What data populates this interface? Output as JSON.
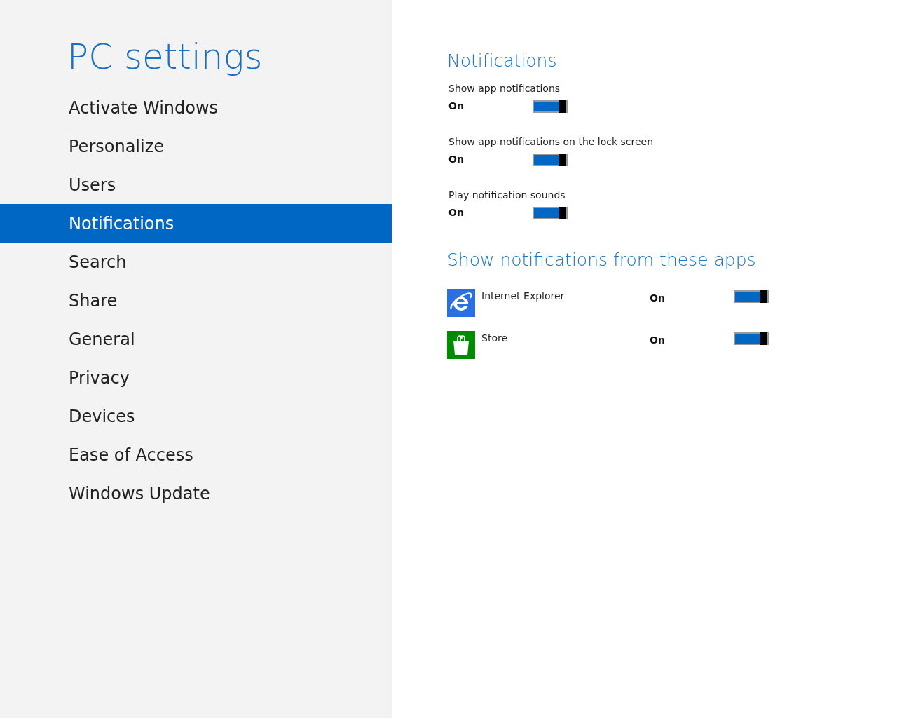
{
  "sidebar": {
    "title": "PC settings",
    "items": [
      {
        "label": "Activate Windows",
        "selected": false
      },
      {
        "label": "Personalize",
        "selected": false
      },
      {
        "label": "Users",
        "selected": false
      },
      {
        "label": "Notifications",
        "selected": true
      },
      {
        "label": "Search",
        "selected": false
      },
      {
        "label": "Share",
        "selected": false
      },
      {
        "label": "General",
        "selected": false
      },
      {
        "label": "Privacy",
        "selected": false
      },
      {
        "label": "Devices",
        "selected": false
      },
      {
        "label": "Ease of Access",
        "selected": false
      },
      {
        "label": "Windows Update",
        "selected": false
      }
    ]
  },
  "notifications": {
    "heading": "Notifications",
    "settings": [
      {
        "label": "Show app notifications",
        "state": "On",
        "on": true
      },
      {
        "label": "Show app notifications on the lock screen",
        "state": "On",
        "on": true
      },
      {
        "label": "Play notification sounds",
        "state": "On",
        "on": true
      }
    ]
  },
  "apps": {
    "heading": "Show notifications from these apps",
    "items": [
      {
        "name": "Internet Explorer",
        "kind": "browser",
        "color": "#2b70e3",
        "state": "On",
        "on": true
      },
      {
        "name": "Store",
        "kind": "store",
        "color": "#008a00",
        "state": "On",
        "on": true
      }
    ]
  }
}
